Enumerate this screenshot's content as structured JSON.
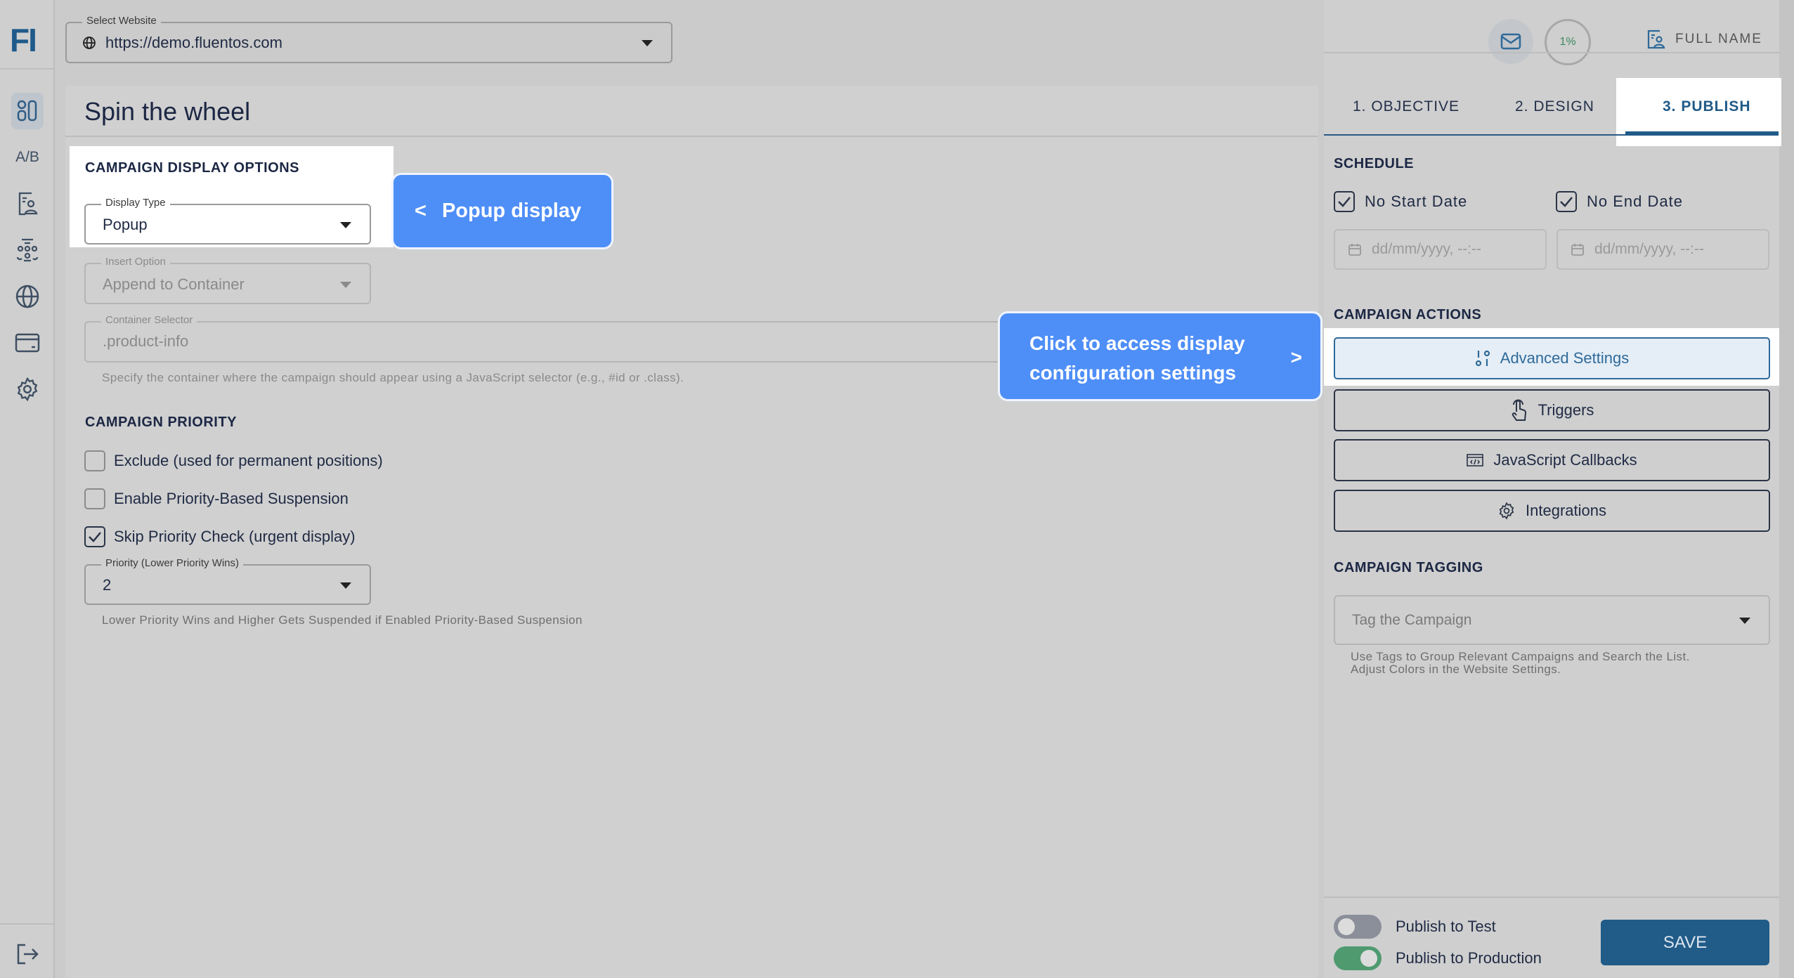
{
  "header": {
    "select_label": "Select Website",
    "website": "https://demo.fluentos.com",
    "progress": "1%",
    "user": "FULL NAME"
  },
  "sidebar": {
    "logo": "FI",
    "items": [
      {
        "icon": "dashboard-icon"
      },
      {
        "label": "A/B",
        "icon": "ab-test-icon"
      },
      {
        "icon": "contact-list-icon"
      },
      {
        "icon": "audience-icon"
      },
      {
        "icon": "globe-icon"
      },
      {
        "icon": "billing-card-icon"
      },
      {
        "icon": "settings-gear-icon"
      }
    ],
    "logout_icon": "logout-icon"
  },
  "main": {
    "title": "Spin the wheel",
    "display_options": {
      "heading": "CAMPAIGN DISPLAY OPTIONS",
      "display_type_label": "Display Type",
      "display_type": "Popup",
      "insert_label": "Insert Option",
      "insert_value": "Append to Container",
      "container_label": "Container Selector",
      "container_value": ".product-info",
      "container_help": "Specify the container where the campaign should appear using a JavaScript selector (e.g., #id or .class)."
    },
    "priority": {
      "heading": "CAMPAIGN PRIORITY",
      "options": [
        {
          "label": "Exclude (used for permanent positions)",
          "checked": false
        },
        {
          "label": "Enable Priority-Based Suspension",
          "checked": false
        },
        {
          "label": "Skip Priority Check (urgent display)",
          "checked": true
        }
      ],
      "priority_label": "Priority (Lower Priority Wins)",
      "priority_value": "2",
      "help": "Lower Priority Wins and Higher Gets Suspended if Enabled Priority-Based Suspension"
    }
  },
  "callouts": {
    "popup": {
      "arrow": "<",
      "text": "Popup display"
    },
    "advanced": {
      "line1": "Click to access display",
      "line2": "configuration settings",
      "arrow": ">"
    },
    "color": "#4e8ef7"
  },
  "right": {
    "tabs": [
      "1. OBJECTIVE",
      "2. DESIGN",
      "3. PUBLISH"
    ],
    "active_tab": "3. PUBLISH",
    "schedule": {
      "heading": "SCHEDULE",
      "no_start": "No Start Date",
      "no_end": "No End Date",
      "start_placeholder": "dd/mm/yyyy, --:--",
      "end_placeholder": "dd/mm/yyyy, --:--"
    },
    "actions": {
      "heading": "CAMPAIGN ACTIONS",
      "buttons": [
        "Advanced Settings",
        "Triggers",
        "JavaScript Callbacks",
        "Integrations"
      ]
    },
    "tagging": {
      "heading": "CAMPAIGN TAGGING",
      "placeholder": "Tag the Campaign",
      "help1": "Use Tags to Group Relevant Campaigns and Search the List.",
      "help2": "Adjust Colors in the Website Settings."
    },
    "footer": {
      "publish_test": "Publish to Test",
      "publish_test_on": false,
      "publish_prod": "Publish to Production",
      "publish_prod_on": true,
      "save": "SAVE"
    }
  },
  "colors": {
    "primary": "#215b88",
    "accent_green": "#4f9a6f"
  }
}
